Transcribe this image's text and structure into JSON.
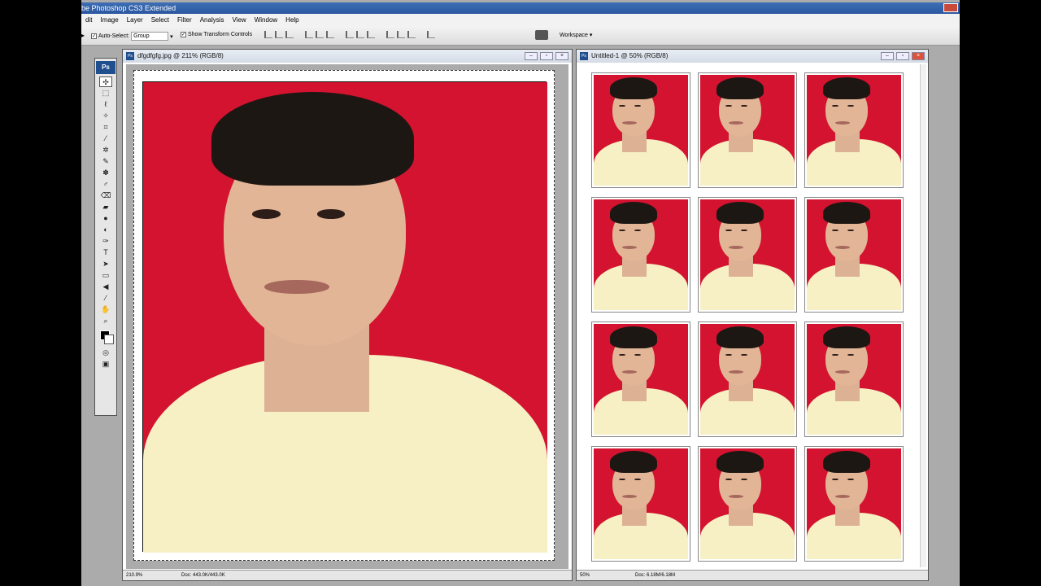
{
  "app": {
    "title": "be Photoshop CS3 Extended"
  },
  "menu": {
    "items": [
      "dit",
      "Image",
      "Layer",
      "Select",
      "Filter",
      "Analysis",
      "View",
      "Window",
      "Help"
    ]
  },
  "options": {
    "auto_select_label": "Auto-Select:",
    "auto_select_value": "Group",
    "show_transform_label": "Show Transform Controls",
    "workspace_label": "Workspace ▾"
  },
  "toolbox": {
    "logo": "Ps",
    "tools": [
      "✣",
      "⬚",
      "ℓ",
      "✧",
      "⌗",
      "⁄",
      "✲",
      "✎",
      "✽",
      "♂",
      "⌫",
      "▰",
      "●",
      "◐",
      "✑",
      "T",
      "➤",
      "▭",
      "◀",
      "⁄",
      "✋",
      "⌕"
    ]
  },
  "doc1": {
    "title": "dfgdfgfg.jpg @ 211% (RGB/8)",
    "zoom": "210.9%",
    "info": "Doc: 443.0K/443.0K"
  },
  "doc2": {
    "title": "Untitled-1 @ 50% (RGB/8)",
    "zoom": "50%",
    "info": "Doc: 6.18M/6.18M",
    "grid": {
      "rows": 4,
      "cols": 3
    }
  },
  "colors": {
    "background_red": "#d3132f",
    "shirt": "#f6f0c4",
    "skin": "#e1b595",
    "hair": "#1d1714"
  }
}
